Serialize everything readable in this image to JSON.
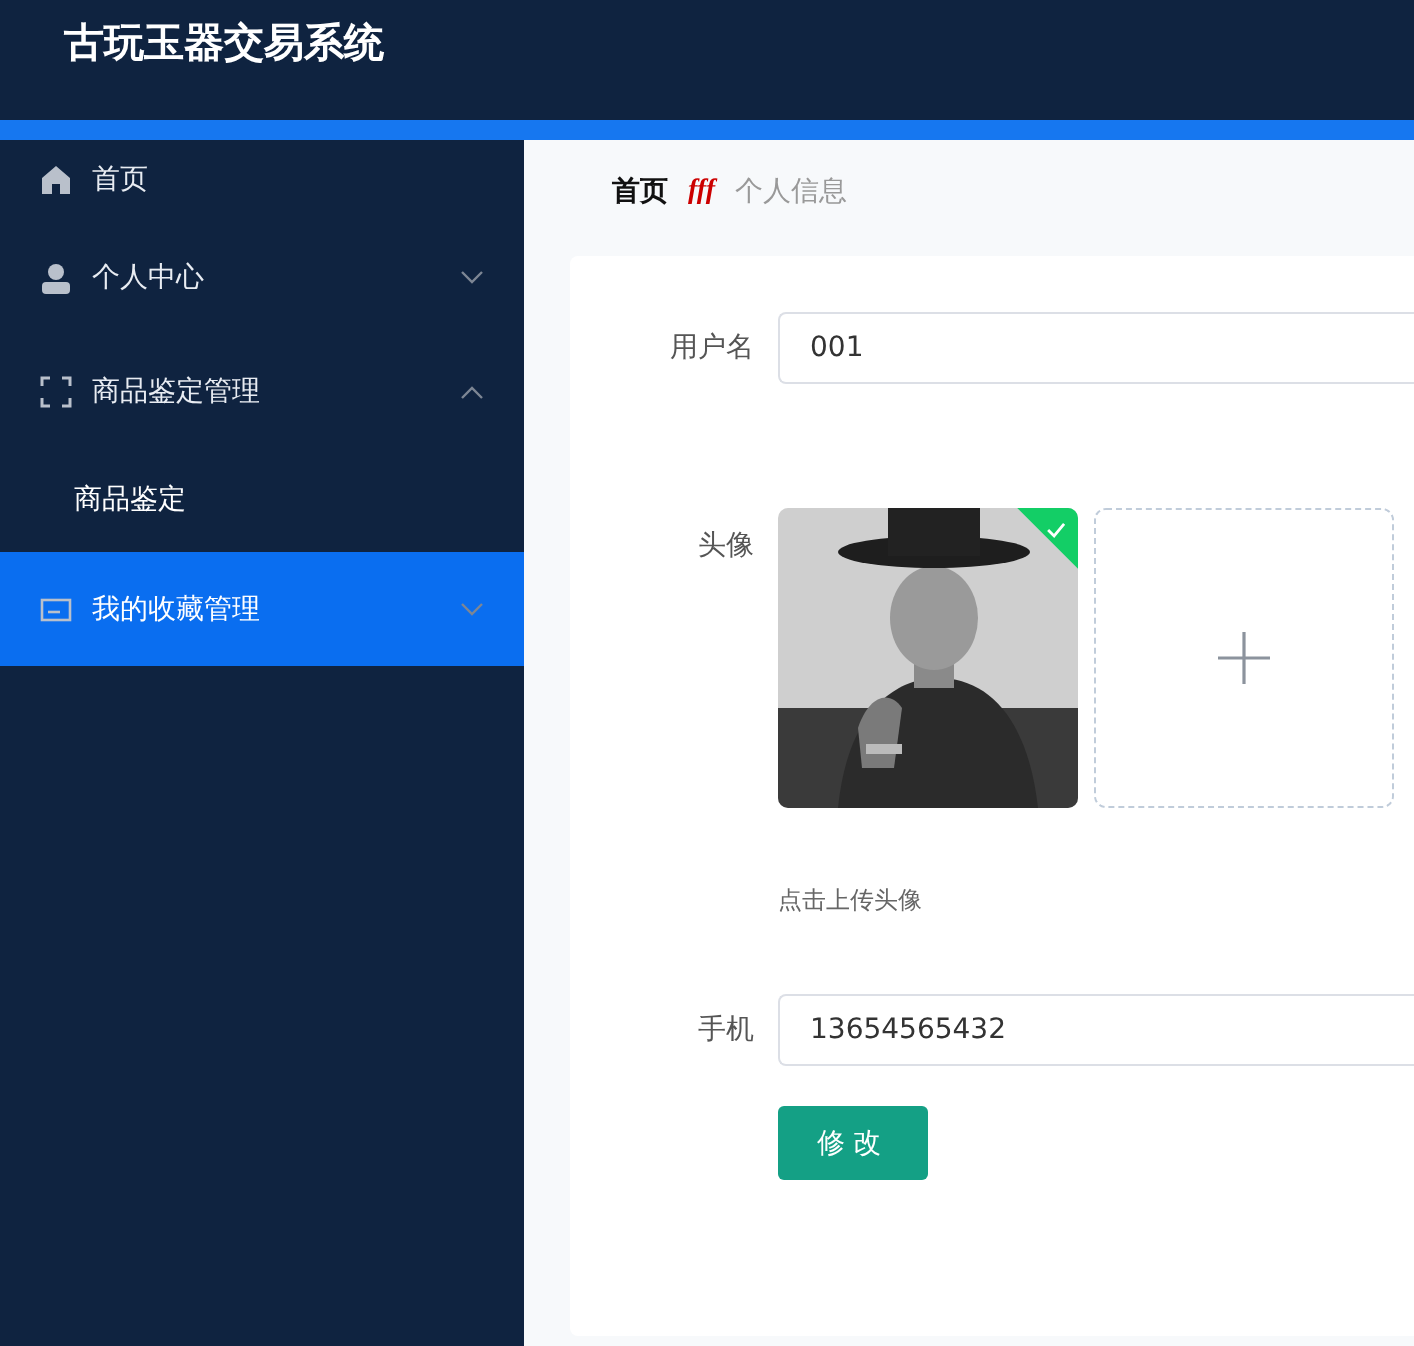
{
  "header": {
    "title": "古玩玉器交易系统"
  },
  "sidebar": {
    "items": [
      {
        "label": "首页",
        "selected": false
      },
      {
        "label": "个人中心",
        "selected": false,
        "expanded": false
      },
      {
        "label": "商品鉴定管理",
        "selected": false,
        "expanded": true,
        "children": [
          {
            "label": "商品鉴定",
            "selected": false
          }
        ]
      },
      {
        "label": "我的收藏管理",
        "selected": true,
        "expanded": false
      }
    ]
  },
  "breadcrumb": {
    "items": [
      "首页",
      "个人信息"
    ],
    "separator": "fff"
  },
  "form": {
    "rows": [
      {
        "kind": "input",
        "label": "用户名",
        "value": "001"
      },
      {
        "kind": "upload",
        "label": "头像",
        "uploaded": true,
        "hint": "点击上传头像"
      },
      {
        "kind": "input",
        "label": "手机",
        "value": "13654565432"
      }
    ],
    "submit": "修改"
  }
}
